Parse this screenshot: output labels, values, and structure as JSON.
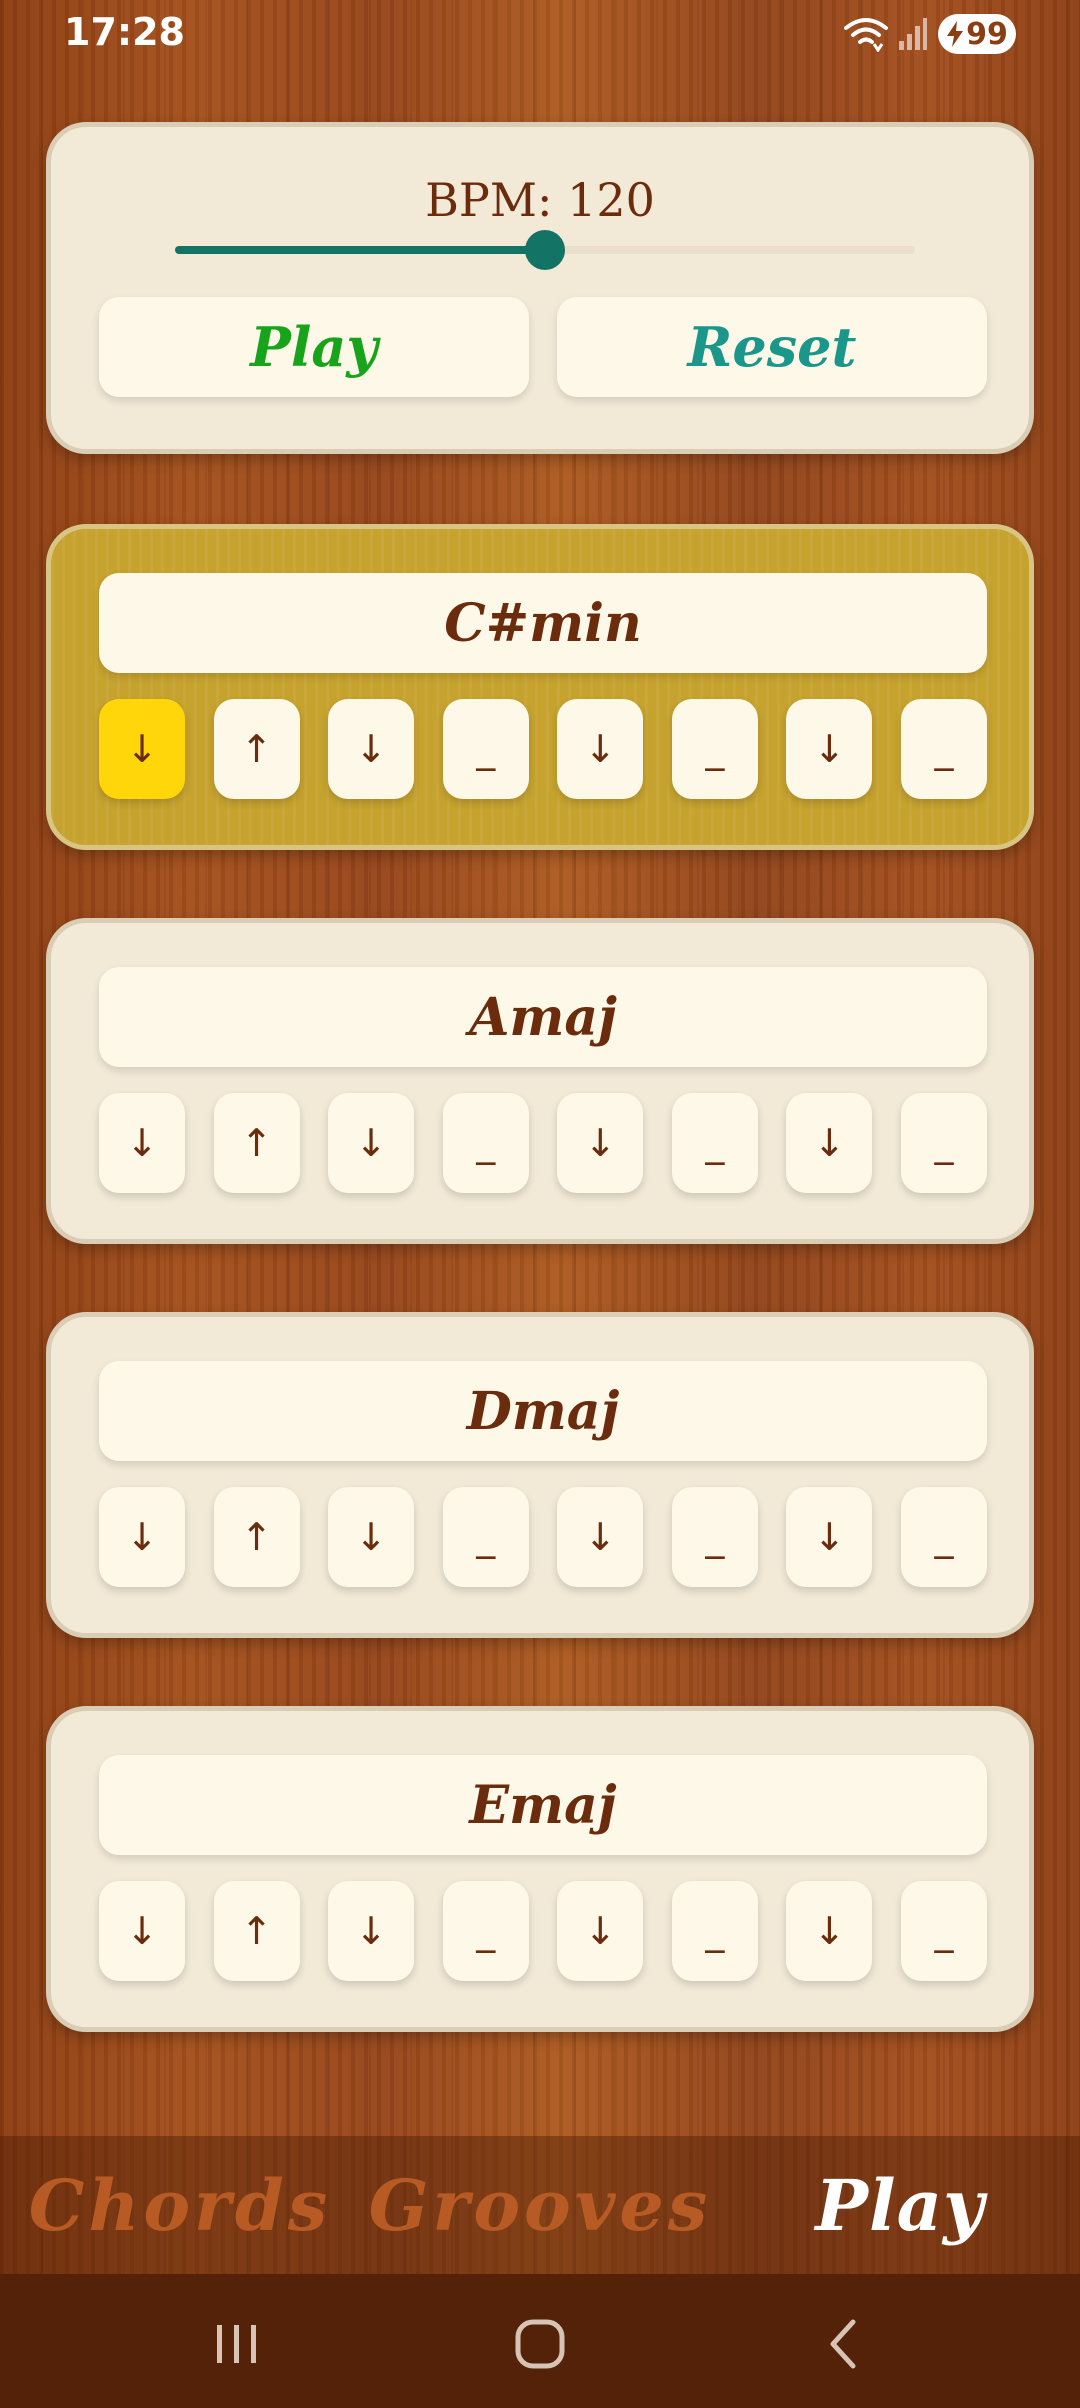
{
  "status_bar": {
    "time": "17:28",
    "battery_level": "99"
  },
  "controls": {
    "bpm_label": "BPM: 120",
    "bpm_value": 120,
    "bpm_slider_fraction": 0.5,
    "play_label": "Play",
    "reset_label": "Reset",
    "accent_color": "#137465",
    "play_color": "#17a31a",
    "reset_color": "#1a968a"
  },
  "chords": [
    {
      "name": "C#min",
      "active": true,
      "current_beat": 0,
      "strums": [
        "↓",
        "↑",
        "↓",
        "_",
        "↓",
        "_",
        "↓",
        "_"
      ]
    },
    {
      "name": "Amaj",
      "active": false,
      "strums": [
        "↓",
        "↑",
        "↓",
        "_",
        "↓",
        "_",
        "↓",
        "_"
      ]
    },
    {
      "name": "Dmaj",
      "active": false,
      "strums": [
        "↓",
        "↑",
        "↓",
        "_",
        "↓",
        "_",
        "↓",
        "_"
      ]
    },
    {
      "name": "Emaj",
      "active": false,
      "strums": [
        "↓",
        "↑",
        "↓",
        "_",
        "↓",
        "_",
        "↓",
        "_"
      ]
    }
  ],
  "active_chord_color": "#c6a22e",
  "current_beat_color": "#ffd60a",
  "bottom_nav": {
    "tabs": [
      {
        "label": "Chords",
        "selected": false
      },
      {
        "label": "Grooves",
        "selected": false
      },
      {
        "label": "Play",
        "selected": true
      }
    ]
  },
  "system_nav": {
    "icons": [
      "recents-icon",
      "home-icon",
      "back-icon"
    ]
  }
}
